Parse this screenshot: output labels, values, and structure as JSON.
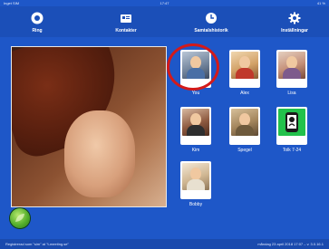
{
  "status_bar": {
    "left": "Inget SIM",
    "time": "17:47",
    "right": "41 %"
  },
  "nav": {
    "items": [
      {
        "label": "Ring",
        "icon": "camera-icon"
      },
      {
        "label": "Kontakter",
        "icon": "contacts-icon"
      },
      {
        "label": "Samtalshistorik",
        "icon": "history-icon"
      },
      {
        "label": "Inställningar",
        "icon": "gear-icon"
      }
    ]
  },
  "contacts": [
    {
      "name": "You"
    },
    {
      "name": "Alex"
    },
    {
      "name": "Lisa"
    },
    {
      "name": "Kim"
    },
    {
      "name": "Spegel"
    },
    {
      "name": "Tolk 7-24"
    },
    {
      "name": "Bobby"
    }
  ],
  "footer": {
    "left": "Registrerad som \"sim\" at \"t-meeting.se\"",
    "right": "måndag 23 april 2018 17:07 – v. 3.0.16.1"
  },
  "colors": {
    "background": "#1e57c8",
    "highlight": "#d31a1a",
    "tolk_tile": "#22c14b"
  }
}
